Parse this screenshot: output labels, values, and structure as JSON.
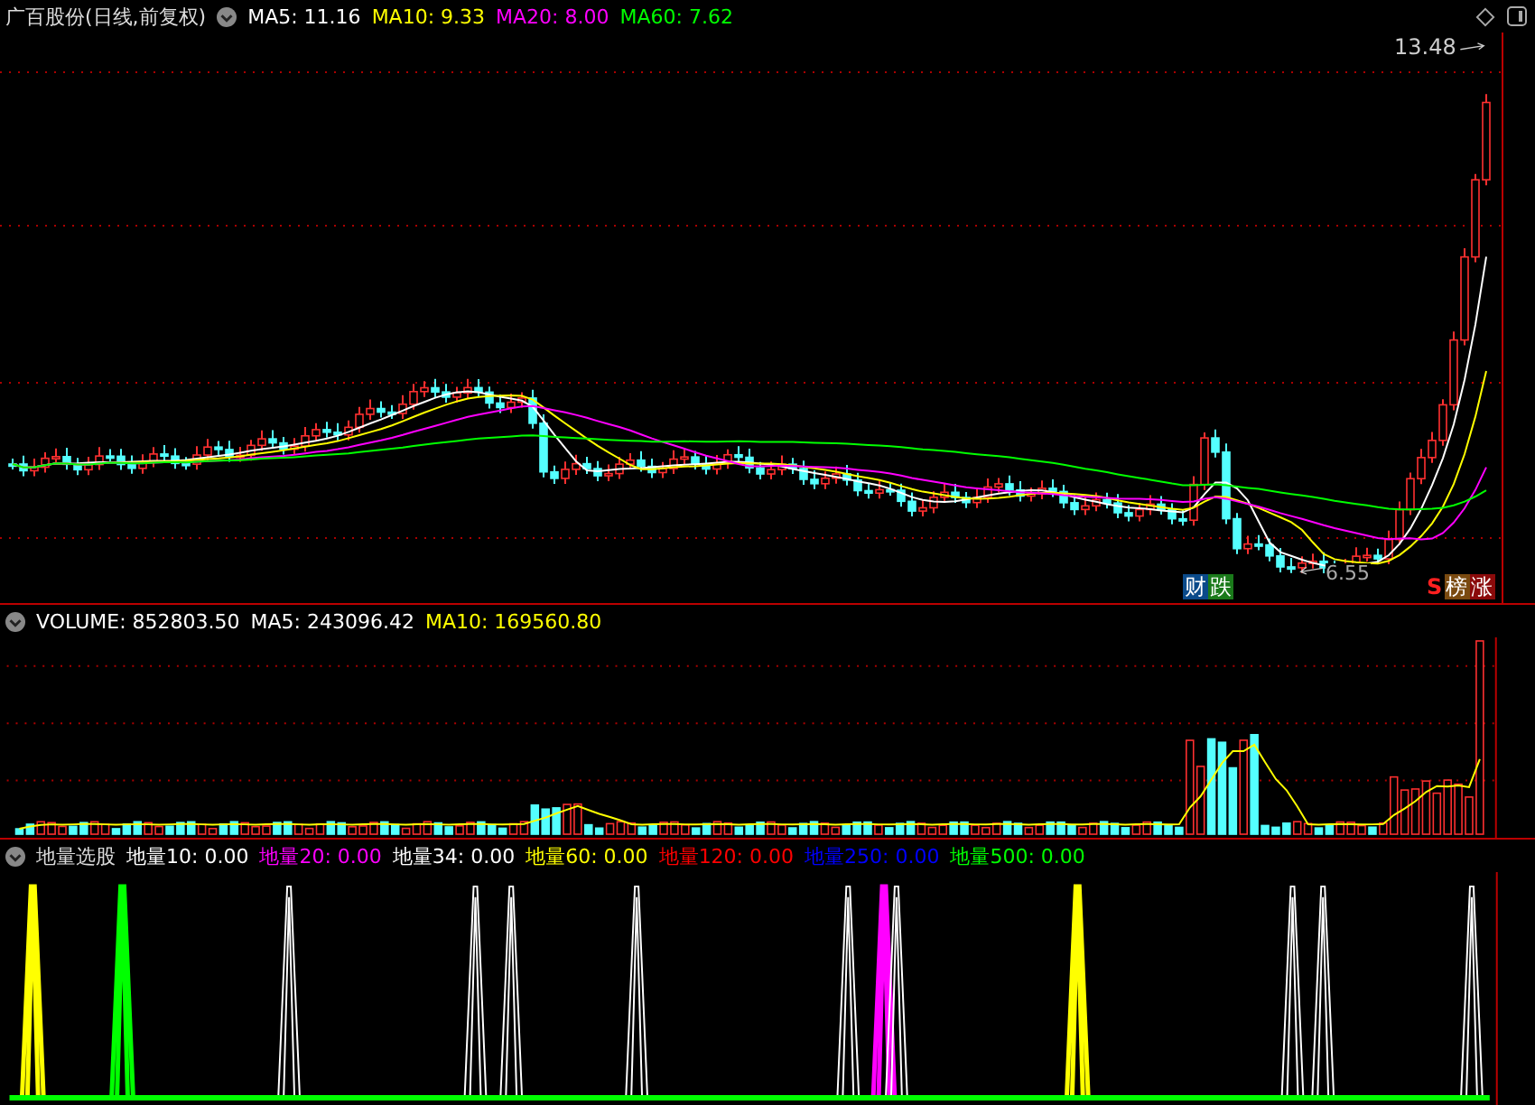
{
  "price_panel": {
    "title": "广百股份(日线,前复权)",
    "legend": [
      {
        "label": "MA5: 11.16",
        "color": "#ffffff"
      },
      {
        "label": "MA10: 9.33",
        "color": "#ffff00"
      },
      {
        "label": "MA20: 8.00",
        "color": "#ff00ff"
      },
      {
        "label": "MA60: 7.62",
        "color": "#00ff00"
      }
    ],
    "high_label": "13.48",
    "low_label": "6.55",
    "tags": [
      {
        "text": "财",
        "color": "#0a4a8a"
      },
      {
        "text": "跌",
        "color": "#1a7a1a"
      }
    ],
    "tags_right": [
      {
        "text": "S",
        "color": "#000000"
      },
      {
        "text": "榜",
        "color": "#7a4a10"
      },
      {
        "text": "涨",
        "color": "#8a0a0a"
      }
    ]
  },
  "volume_panel": {
    "legend": [
      {
        "label": "VOLUME: 852803.50",
        "color": "#ffffff"
      },
      {
        "label": "MA5: 243096.42",
        "color": "#ffffff"
      },
      {
        "label": "MA10: 169560.80",
        "color": "#ffff00"
      }
    ]
  },
  "indicator_panel": {
    "title": "地量选股",
    "legend": [
      {
        "label": "地量10: 0.00",
        "color": "#ffffff"
      },
      {
        "label": "地量20: 0.00",
        "color": "#ff00ff"
      },
      {
        "label": "地量34: 0.00",
        "color": "#ffffff"
      },
      {
        "label": "地量60: 0.00",
        "color": "#ffff00"
      },
      {
        "label": "地量120: 0.00",
        "color": "#ff0000"
      },
      {
        "label": "地量250: 0.00",
        "color": "#0000ff"
      },
      {
        "label": "地量500: 0.00",
        "color": "#00ff00"
      }
    ]
  }
}
